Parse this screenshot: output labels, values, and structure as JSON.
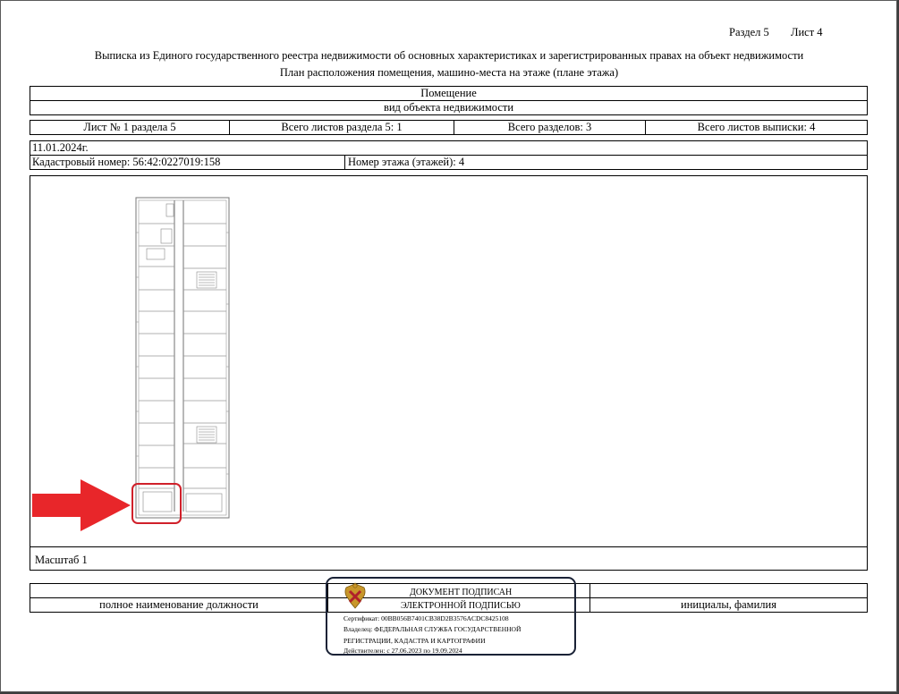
{
  "header": {
    "section": "Раздел 5",
    "sheet": "Лист 4",
    "title": "Выписка из Единого государственного реестра недвижимости об основных характеристиках и зарегистрированных правах на объект недвижимости",
    "subtitle": "План расположения помещения, машино-места на этаже (плане этажа)"
  },
  "object": {
    "type_value": "Помещение",
    "type_caption": "вид объекта недвижимости"
  },
  "sheet_info": {
    "sheet_of_section": "Лист № 1 раздела 5",
    "total_sheets_section": "Всего листов раздела 5: 1",
    "total_sections": "Всего разделов: 3",
    "total_sheets_extract": "Всего листов выписки: 4"
  },
  "date": "11.01.2024г.",
  "cadastral_number": "Кадастровый номер: 56:42:0227019:158",
  "floor_number": "Номер этажа (этажей): 4",
  "scale": "Масштаб 1",
  "signature": {
    "position_caption": "полное наименование должности",
    "name_caption": "инициалы, фамилия"
  },
  "stamp": {
    "line1": "ДОКУМЕНТ ПОДПИСАН",
    "line2": "ЭЛЕКТРОННОЙ ПОДПИСЬЮ",
    "certificate": "Сертификат: 00BB056B7401CB38D2B3576ACDC8425108",
    "owner_line1": "Владелец: ФЕДЕРАЛЬНАЯ СЛУЖБА ГОСУДАРСТВЕННОЙ",
    "owner_line2": "РЕГИСТРАЦИИ, КАДАСТРА И КАРТОГРАФИИ",
    "validity": "Действителен: с 27.06.2023 по 19.09.2024"
  },
  "colors": {
    "arrow": "#e8262a",
    "highlight": "#d0202a",
    "stamp_border": "#1a2236"
  }
}
